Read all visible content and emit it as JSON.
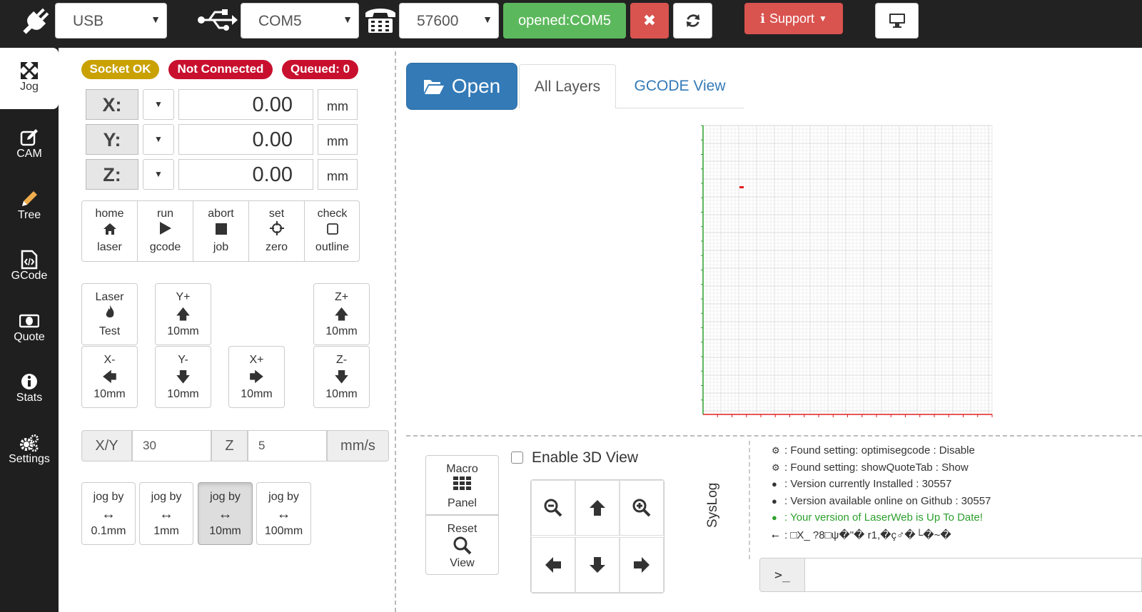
{
  "topbar": {
    "connection_type": "USB",
    "port": "COM5",
    "baud": "57600",
    "status_button": "opened:COM5",
    "support_label": "Support",
    "colors": {
      "green": "#5cb85c",
      "red": "#d9534f",
      "bar": "#222222"
    }
  },
  "sidebar": {
    "items": [
      {
        "label": "Jog",
        "icon": "arrows-icon"
      },
      {
        "label": "CAM",
        "icon": "edit-icon"
      },
      {
        "label": "Tree",
        "icon": "pencil-icon"
      },
      {
        "label": "GCode",
        "icon": "code-file-icon"
      },
      {
        "label": "Quote",
        "icon": "money-icon"
      },
      {
        "label": "Stats",
        "icon": "info-icon"
      },
      {
        "label": "Settings",
        "icon": "cogs-icon"
      }
    ]
  },
  "badges": {
    "socket": "Socket OK",
    "connection": "Not Connected",
    "queued": "Queued: 0"
  },
  "dro": {
    "x": {
      "label": "X:",
      "value": "0.00",
      "unit": "mm"
    },
    "y": {
      "label": "Y:",
      "value": "0.00",
      "unit": "mm"
    },
    "z": {
      "label": "Z:",
      "value": "0.00",
      "unit": "mm"
    }
  },
  "controls": [
    {
      "l1": "home",
      "l3": "laser",
      "icon": "home-icon"
    },
    {
      "l1": "run",
      "l3": "gcode",
      "icon": "play-icon"
    },
    {
      "l1": "abort",
      "l3": "job",
      "icon": "stop-icon"
    },
    {
      "l1": "set",
      "l3": "zero",
      "icon": "crosshair-icon"
    },
    {
      "l1": "check",
      "l3": "outline",
      "icon": "square-icon"
    }
  ],
  "jog": {
    "laser_test": {
      "l1": "Laser",
      "l3": "Test"
    },
    "y_plus": {
      "l1": "Y+",
      "l3": "10mm"
    },
    "z_plus": {
      "l1": "Z+",
      "l3": "10mm"
    },
    "x_minus": {
      "l1": "X-",
      "l3": "10mm"
    },
    "y_minus": {
      "l1": "Y-",
      "l3": "10mm"
    },
    "x_plus": {
      "l1": "X+",
      "l3": "10mm"
    },
    "z_minus": {
      "l1": "Z-",
      "l3": "10mm"
    }
  },
  "speed": {
    "xy_label": "X/Y",
    "xy_value": "30",
    "z_label": "Z",
    "z_value": "5",
    "unit": "mm/s"
  },
  "jog_by": [
    {
      "l1": "jog by",
      "l3": "0.1mm",
      "active": false
    },
    {
      "l1": "jog by",
      "l3": "1mm",
      "active": false
    },
    {
      "l1": "jog by",
      "l3": "10mm",
      "active": true
    },
    {
      "l1": "jog by",
      "l3": "100mm",
      "active": false
    }
  ],
  "tabs": {
    "open": "Open",
    "all_layers": "All Layers",
    "gcode_view": "GCODE View"
  },
  "view": {
    "macro": {
      "l1": "Macro",
      "l3": "Panel"
    },
    "reset": {
      "l1": "Reset",
      "l3": "View"
    },
    "enable3d": "Enable 3D View"
  },
  "syslog": {
    "title": "SysLog",
    "lines": [
      {
        "icon": "cogs-icon",
        "text": ": Found setting: optimisegcode : Disable",
        "color": "#333333"
      },
      {
        "icon": "cogs-icon",
        "text": ": Found setting: showQuoteTab : Show",
        "color": "#333333"
      },
      {
        "icon": "github-icon",
        "text": ": Version currently Installed : 30557",
        "color": "#333333"
      },
      {
        "icon": "github-icon",
        "text": ": Version available online on Github : 30557",
        "color": "#333333"
      },
      {
        "icon": "github-icon",
        "text": ": Your version of LaserWeb is Up To Date!",
        "color": "#2ca02c"
      },
      {
        "icon": "usb-icon",
        "text": ": □X_ ?8□ψ�\"� r1,�ç♂�└�~�",
        "color": "#333333"
      }
    ]
  },
  "console": {
    "prompt": ">_"
  }
}
